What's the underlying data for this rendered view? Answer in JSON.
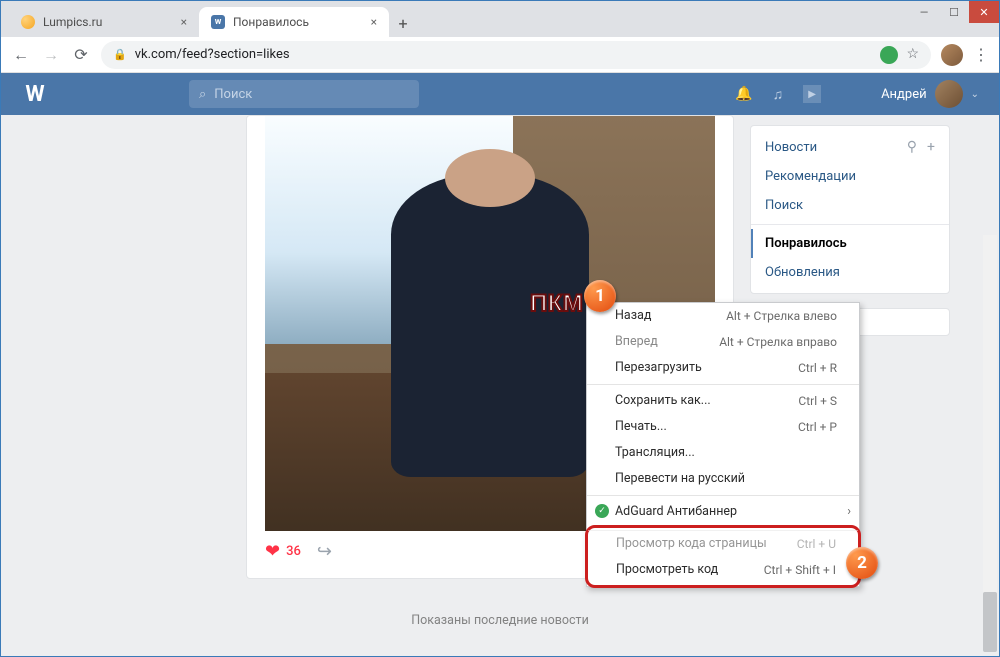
{
  "window": {
    "min": "—",
    "max": "☐",
    "close": "✕"
  },
  "tabs": [
    {
      "title": "Lumpics.ru"
    },
    {
      "title": "Понравилось"
    }
  ],
  "new_tab": "+",
  "url_bar": {
    "back": "←",
    "forward": "→",
    "reload": "⟳",
    "url": "vk.com/feed?section=likes",
    "star": "☆",
    "menu": "⋮"
  },
  "vk": {
    "logo": "W",
    "search_placeholder": "Поиск",
    "search_icon": "⌕",
    "bell": "🔔",
    "music": "♫",
    "play": "▶",
    "username": "Андрей",
    "user_arrow": "⌄"
  },
  "post": {
    "likes": "36"
  },
  "sidebar": {
    "items": [
      "Новости",
      "Рекомендации",
      "Поиск",
      "Понравилось",
      "Обновления"
    ],
    "filter_icon": "⚲",
    "add_icon": "+"
  },
  "footer": "Показаны последние новости",
  "context_menu": {
    "items": [
      {
        "label": "Назад",
        "shortcut": "Alt + Стрелка влево"
      },
      {
        "label": "Вперед",
        "shortcut": "Alt + Стрелка вправо"
      },
      {
        "label": "Перезагрузить",
        "shortcut": "Ctrl + R"
      }
    ],
    "group2": [
      {
        "label": "Сохранить как...",
        "shortcut": "Ctrl + S"
      },
      {
        "label": "Печать...",
        "shortcut": "Ctrl + P"
      },
      {
        "label": "Трансляция..."
      },
      {
        "label": "Перевести на русский"
      }
    ],
    "adguard": "AdGuard Антибаннер",
    "final": [
      {
        "label": "Просмотр кода страницы",
        "shortcut": "Ctrl + U"
      },
      {
        "label": "Просмотреть код",
        "shortcut": "Ctrl + Shift + I"
      }
    ]
  },
  "annotations": {
    "pkm": "ПКМ",
    "b1": "1",
    "b2": "2"
  }
}
